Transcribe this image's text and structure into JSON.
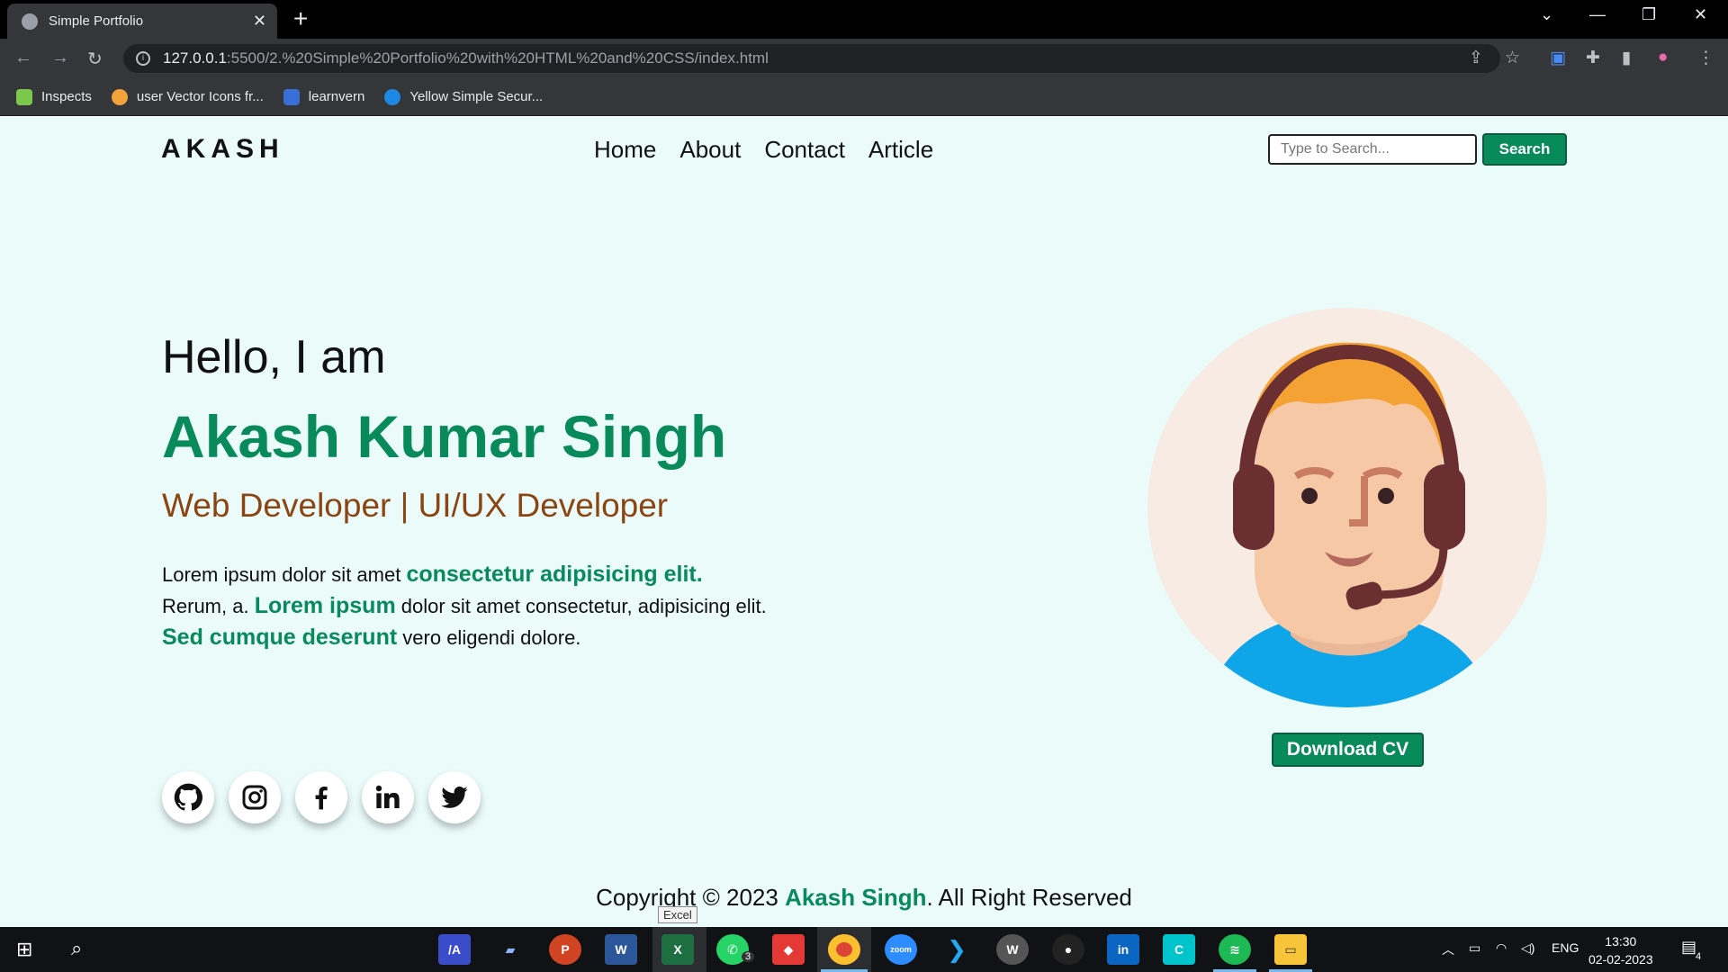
{
  "browser": {
    "tab_title": "Simple Portfolio",
    "url_host": "127.0.0.1",
    "url_path": ":5500/2.%20Simple%20Portfolio%20with%20HTML%20and%20CSS/index.html",
    "bookmarks": [
      {
        "label": "Inspects",
        "color": "#7cc84a"
      },
      {
        "label": "user Vector Icons fr...",
        "color": "#f2a33a"
      },
      {
        "label": "learnvern",
        "color": "#3a6fd8"
      },
      {
        "label": "Yellow Simple Secur...",
        "color": "#1e88e5"
      }
    ]
  },
  "site": {
    "logo": "AKASH",
    "nav": [
      "Home",
      "About",
      "Contact",
      "Article"
    ],
    "search_placeholder": "Type to Search...",
    "search_button": "Search",
    "hello": "Hello, I am",
    "name": "Akash Kumar Singh",
    "role": "Web Developer | UI/UX Developer",
    "para": {
      "l1a": "Lorem ipsum dolor sit amet ",
      "l1b": "consectetur adipisicing elit.",
      "l2a": "Rerum, a. ",
      "l2b": "Lorem ipsum",
      "l2c": " dolor sit amet consectetur, adipisicing elit.",
      "l3a": "Sed cumque deserunt",
      "l3b": " vero eligendi dolore."
    },
    "socials": [
      "github-icon",
      "instagram-icon",
      "facebook-icon",
      "linkedin-icon",
      "twitter-icon"
    ],
    "cv_button": "Download CV",
    "footer": {
      "a": "Copyright © 2023 ",
      "b": "Akash Singh",
      "c": ". All Right Reserved"
    },
    "accent_color": "#088a5a",
    "role_color": "#8b4513"
  },
  "tooltip": "Excel",
  "taskbar": {
    "whatsapp_badge": "3",
    "lang": "ENG",
    "time": "13:30",
    "date": "02-02-2023",
    "notification_count": "4"
  }
}
